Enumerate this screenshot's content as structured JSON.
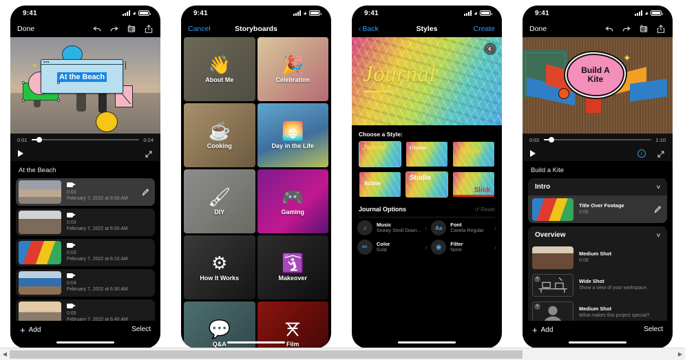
{
  "status_bar": {
    "time": "9:41",
    "signal": "cellular-bars",
    "wifi": "wifi-icon",
    "battery": "battery-icon"
  },
  "panel1": {
    "nav": {
      "left": "Done",
      "undo": "undo-icon",
      "redo": "redo-icon",
      "storyboard": "storyboard-icon",
      "share": "share-icon"
    },
    "preview": {
      "text_card": "At the Beach"
    },
    "scrubber": {
      "current": "0:01",
      "total": "0:24"
    },
    "project_title": "At the Beach",
    "clips": [
      {
        "duration": "0:03",
        "date": "February 7, 2022 at 6:50 AM",
        "selected": true,
        "thumb": "ph-beach"
      },
      {
        "duration": "0:03",
        "date": "February 7, 2022 at 6:00 AM",
        "selected": false,
        "thumb": "ph-people"
      },
      {
        "duration": "0:03",
        "date": "February 7, 2022 at 6:10 AM",
        "selected": false,
        "thumb": "ph-kite"
      },
      {
        "duration": "0:04",
        "date": "February 7, 2022 at 6:30 AM",
        "selected": false,
        "thumb": "ph-sit"
      },
      {
        "duration": "0:05",
        "date": "February 7, 2022 at 6:40 AM",
        "selected": false,
        "thumb": "ph-fam"
      }
    ],
    "bottom": {
      "add": "Add",
      "select": "Select"
    }
  },
  "panel2": {
    "nav": {
      "cancel": "Cancel",
      "title": "Storyboards"
    },
    "cells": [
      {
        "label": "About Me",
        "icon": "waving-hands-icon",
        "bg": "linear-gradient(135deg,#6d6a58,#4f4c42)"
      },
      {
        "label": "Celebration",
        "icon": "party-popper-icon",
        "bg": "linear-gradient(135deg,#d8c79a,#b56b74)"
      },
      {
        "label": "Cooking",
        "icon": "coffee-cup-icon",
        "bg": "linear-gradient(135deg,#a8906a,#6d5a40)"
      },
      {
        "label": "Day in the Life",
        "icon": "sunrise-icon",
        "bg": "linear-gradient(160deg,#5fa7cf,#3f6f9c 55%,#b9c05a)"
      },
      {
        "label": "DIY",
        "icon": "paint-roller-icon",
        "bg": "linear-gradient(135deg,#8d8d8d,#6a6a63)"
      },
      {
        "label": "Gaming",
        "icon": "game-controller-icon",
        "bg": "linear-gradient(135deg,#7c1b8f,#c2188f 60%,#5a1078)"
      },
      {
        "label": "How It Works",
        "icon": "gears-flow-icon",
        "bg": "linear-gradient(135deg,#3a3a3a,#151515)"
      },
      {
        "label": "Makeover",
        "icon": "mirror-sparkle-icon",
        "bg": "linear-gradient(135deg,#2e2e2e,#0e0e0e)"
      },
      {
        "label": "Q&A",
        "icon": "speech-question-icon",
        "bg": "linear-gradient(135deg,#4d6f70,#2e4445)"
      },
      {
        "label": "Film",
        "icon": "director-chair-icon",
        "bg": "linear-gradient(135deg,#8b1410,#3d0604)"
      }
    ]
  },
  "panel3": {
    "nav": {
      "back": "Back",
      "title": "Styles",
      "create": "Create"
    },
    "hero": {
      "word": "Journal",
      "mute": "mute-icon"
    },
    "choose_label": "Choose a Style:",
    "styles": [
      {
        "name": "Journal",
        "color": "#f2e04a",
        "font": "serif",
        "selected": "blue"
      },
      {
        "name": "Ornate",
        "color": "#f4f0e2",
        "font": "serif",
        "selected": "none"
      },
      {
        "name": "Charm",
        "color": "#f6cf3a",
        "font": "serif",
        "selected": "none"
      },
      {
        "name": "Active",
        "color": "#ffffff",
        "font": "sans",
        "selected": "none"
      },
      {
        "name": "Studio",
        "color": "#ffffff",
        "font": "sans",
        "selected": "orange"
      },
      {
        "name": "Slick",
        "color": "#e02a15",
        "font": "sans",
        "selected": "none"
      }
    ],
    "options_title": "Journal Options",
    "reset": "Reset",
    "options": [
      {
        "name": "Music",
        "value": "Snowy Stroll Down...",
        "icon": "music-note-icon"
      },
      {
        "name": "Font",
        "value": "Canela Regular",
        "icon": "font-aa-icon"
      },
      {
        "name": "Color",
        "value": "Gold",
        "icon": "eyedropper-icon"
      },
      {
        "name": "Filter",
        "value": "None",
        "icon": "filter-icon"
      }
    ]
  },
  "panel4": {
    "nav": {
      "left": "Done",
      "undo": "undo-icon",
      "redo": "redo-icon",
      "storyboard": "storyboard-icon",
      "share": "share-icon"
    },
    "preview": {
      "bubble_line1": "Build A",
      "bubble_line2": "Kite"
    },
    "scrubber": {
      "current": "0:02",
      "total": "1:10"
    },
    "info": "info-icon",
    "project_title": "Build a Kite",
    "sections": [
      {
        "title": "Intro",
        "shots": [
          {
            "title": "Title Over Footage",
            "sub": "0:05",
            "active": true,
            "placeholder": false,
            "thumb": "ph-kite",
            "edit": "pencil-icon"
          }
        ]
      },
      {
        "title": "Overview",
        "shots": [
          {
            "title": "Medium Shot",
            "sub": "0:08",
            "active": false,
            "placeholder": false,
            "thumb": "ph-woman"
          },
          {
            "title": "Wide Shot",
            "sub": "Show a view of your workspace.",
            "active": false,
            "placeholder": true,
            "thumb": "desk-icon"
          },
          {
            "title": "Medium Shot",
            "sub": "What makes this project special?",
            "active": false,
            "placeholder": true,
            "thumb": "person-icon"
          }
        ]
      }
    ],
    "bottom": {
      "add": "Add",
      "select": "Select"
    }
  },
  "scrollbar": {
    "left_arrow": "◀",
    "right_arrow": "▶"
  }
}
